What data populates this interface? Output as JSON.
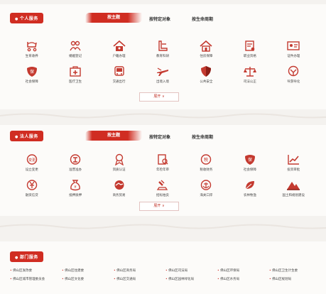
{
  "personal": {
    "label": "个人服务",
    "tabs": [
      "按主题",
      "按特定对象",
      "按生命周期"
    ],
    "items": [
      {
        "label": "生育收养",
        "icon": "stroller-icon"
      },
      {
        "label": "婚姻登记",
        "icon": "couple-icon"
      },
      {
        "label": "户籍办理",
        "icon": "household-icon"
      },
      {
        "label": "教育科研",
        "icon": "education-icon"
      },
      {
        "label": "住房保障",
        "icon": "house-icon"
      },
      {
        "label": "职业资格",
        "icon": "certificate-icon"
      },
      {
        "label": "证件办理",
        "icon": "id-card-icon"
      },
      {
        "label": "社会保障",
        "icon": "social-security-icon"
      },
      {
        "label": "医疗卫生",
        "icon": "medical-kit-icon"
      },
      {
        "label": "交通出行",
        "icon": "bus-icon"
      },
      {
        "label": "出境入境",
        "icon": "plane-icon"
      },
      {
        "label": "公共安全",
        "icon": "shield-icon"
      },
      {
        "label": "司法公正",
        "icon": "scales-icon"
      },
      {
        "label": "导游导化",
        "icon": "guide-icon"
      }
    ],
    "expand": "展开"
  },
  "legal": {
    "label": "法人服务",
    "tabs": [
      "按主题",
      "按特定对象",
      "按生命周期"
    ],
    "items": [
      {
        "label": "设立变更",
        "icon": "change-icon"
      },
      {
        "label": "准营准办",
        "icon": "permit-icon"
      },
      {
        "label": "资质认证",
        "icon": "award-icon"
      },
      {
        "label": "年检年审",
        "icon": "inspection-icon"
      },
      {
        "label": "税收财务",
        "icon": "tax-icon"
      },
      {
        "label": "社会保障",
        "icon": "social-security-icon"
      },
      {
        "label": "投资审批",
        "icon": "chart-icon"
      },
      {
        "label": "融资信贷",
        "icon": "yuan-icon"
      },
      {
        "label": "抵押质押",
        "icon": "money-bag-icon"
      },
      {
        "label": "商务贸易",
        "icon": "handshake-icon"
      },
      {
        "label": "招标拍卖",
        "icon": "gavel-icon"
      },
      {
        "label": "海关口岸",
        "icon": "anchor-icon"
      },
      {
        "label": "农林牧渔",
        "icon": "leaf-icon"
      },
      {
        "label": "国土和规划建设",
        "icon": "mountain-icon"
      }
    ],
    "expand": "展开"
  },
  "dept": {
    "label": "部门服务",
    "items": [
      "佛山区发改委",
      "佛山区住建委",
      "佛山区商务局",
      "佛山区司法局",
      "佛山区环保局",
      "佛山区卫生计生委",
      "佛山区城市管理委员会",
      "佛山区文化委",
      "佛山区交通局",
      "佛山区园林绿化局",
      "佛山区水务局",
      "佛山区规划局"
    ]
  },
  "colors": {
    "accent": "#d02d22",
    "background": "#f4f2ef"
  }
}
